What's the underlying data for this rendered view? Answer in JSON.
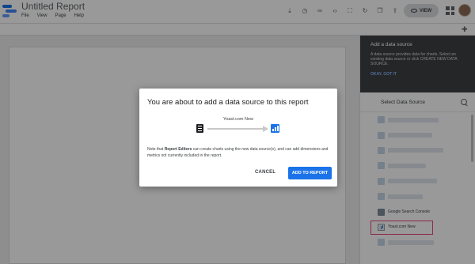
{
  "app": {
    "title": "Untitled Report",
    "menu": [
      "File",
      "View",
      "Page",
      "Help"
    ],
    "view_label": "VIEW"
  },
  "sidebar": {
    "help_title": "Add a data source",
    "help_text": "A data source provides data for charts. Select an existing data source or click CREATE NEW DATA SOURCE.",
    "help_link": "OKAY, GOT IT",
    "header": "Select Data Source",
    "items": [
      {
        "label": ""
      },
      {
        "label": ""
      },
      {
        "label": ""
      },
      {
        "label": ""
      },
      {
        "label": ""
      },
      {
        "label": ""
      },
      {
        "label": "Google Search Console"
      },
      {
        "label": "Yoast.com New"
      },
      {
        "label": ""
      }
    ]
  },
  "dialog": {
    "title": "You are about to add a data source to this report",
    "data_source_name": "Yoast.com New",
    "body_prefix": "Note that ",
    "body_bold": "Report Editors",
    "body_suffix": " can create charts using the new data source(s), and can add dimensions and metrics not currently included in the report.",
    "cancel_label": "CANCEL",
    "confirm_label": "ADD TO REPORT"
  }
}
